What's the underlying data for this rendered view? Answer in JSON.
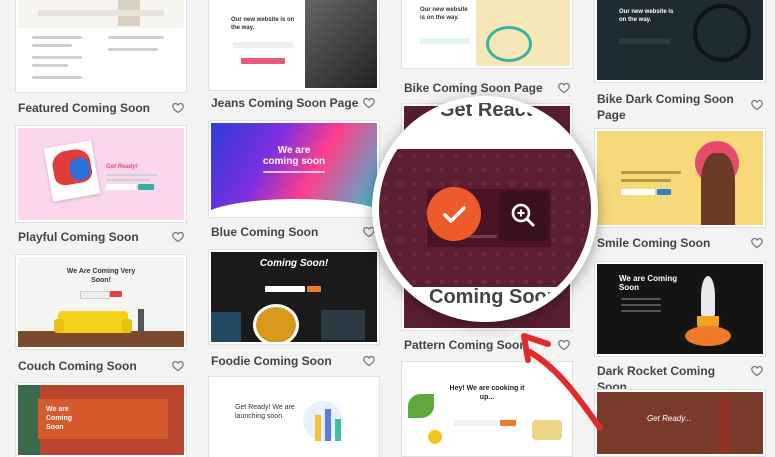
{
  "templates": {
    "featured": {
      "label": "Featured Coming Soon"
    },
    "jeans": {
      "label": "Jeans Coming Soon Page",
      "preview_title": "Our new website is on the way."
    },
    "bike": {
      "label": "Bike Coming Soon Page",
      "preview_title": "Our new website is on the way."
    },
    "bike_dark": {
      "label": "Bike Dark Coming Soon Page",
      "preview_title": "Our new website is on the way."
    },
    "playful": {
      "label": "Playful Coming Soon",
      "preview_title": "Get Ready!"
    },
    "blue": {
      "label": "Blue Coming Soon",
      "preview_title": "We are coming soon"
    },
    "pattern": {
      "label": "Pattern Coming Soon",
      "preview_title_top": "Get React",
      "preview_title_bottom": "Coming Soon"
    },
    "smile": {
      "label": "Smile Coming Soon"
    },
    "couch": {
      "label": "Couch Coming Soon",
      "preview_title": "We Are Coming Very Soon!"
    },
    "foodie": {
      "label": "Foodie Coming Soon",
      "preview_title": "Coming Soon!"
    },
    "dark_rocket": {
      "label": "Dark Rocket Coming Soon",
      "preview_title": "We are Coming Soon"
    },
    "red_couch": {
      "preview_title": "We are Coming Soon"
    },
    "get_ready": {
      "preview_title": "Get Ready! We are launching soon."
    },
    "hey": {
      "preview_title": "Hey! We are cooking it up..."
    },
    "bridge": {
      "preview_title": "Get Ready..."
    }
  },
  "icons": {
    "favorite": "heart-icon",
    "select": "check-icon",
    "preview": "zoom-in-icon",
    "annotation": "arrow"
  },
  "colors": {
    "accent": "#f15b2a",
    "annotation_red": "#e02b2b",
    "label": "#444444"
  }
}
